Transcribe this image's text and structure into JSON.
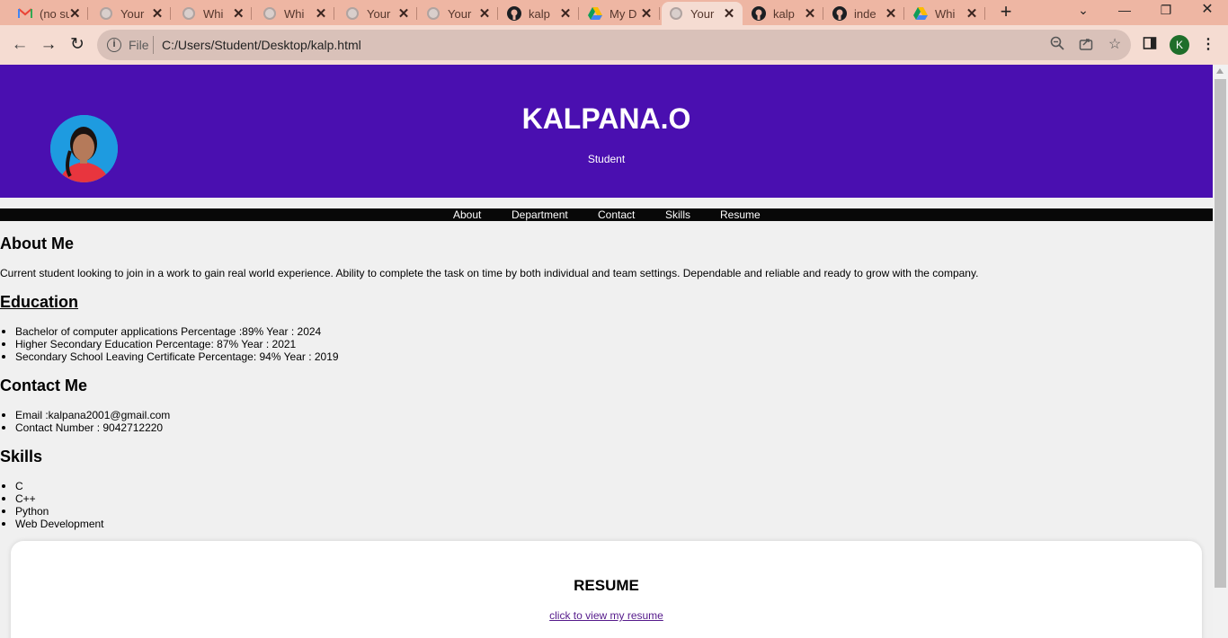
{
  "browser": {
    "tabs": [
      {
        "title": "(no subject)",
        "icon": "gmail-icon"
      },
      {
        "title": "Your",
        "icon": "globe-icon"
      },
      {
        "title": "Whi",
        "icon": "globe-icon"
      },
      {
        "title": "Whi",
        "icon": "globe-icon"
      },
      {
        "title": "Your",
        "icon": "globe-icon"
      },
      {
        "title": "Your",
        "icon": "globe-icon"
      },
      {
        "title": "kalp",
        "icon": "github-icon"
      },
      {
        "title": "My D",
        "icon": "drive-icon"
      },
      {
        "title": "Your",
        "icon": "globe-icon",
        "active": true
      },
      {
        "title": "kalp",
        "icon": "github-icon"
      },
      {
        "title": "inde",
        "icon": "github-icon"
      },
      {
        "title": "Whi",
        "icon": "drive-icon"
      }
    ],
    "address": {
      "scheme_label": "File",
      "url": "C:/Users/Student/Desktop/kalp.html"
    },
    "profile_initial": "K"
  },
  "header": {
    "name": "KALPANA.O",
    "role": "Student",
    "bg_color": "#4a0fb0"
  },
  "nav": {
    "links": [
      "About",
      "Department",
      "Contact",
      "Skills",
      "Resume"
    ]
  },
  "about": {
    "heading": "About Me",
    "text": "Current student looking to join in a work to gain real world experience. Ability to complete the task on time by both individual and team settings. Dependable and reliable and ready to grow with the company."
  },
  "education": {
    "heading": "Education",
    "items": [
      "Bachelor of computer applications Percentage :89% Year : 2024",
      "Higher Secondary Education Percentage: 87% Year : 2021",
      "Secondary School Leaving Certificate Percentage: 94% Year : 2019"
    ]
  },
  "contact": {
    "heading": "Contact Me",
    "items": [
      "Email :kalpana2001@gmail.com",
      "Contact Number : 9042712220"
    ]
  },
  "skills": {
    "heading": "Skills",
    "items": [
      "C",
      "C++",
      "Python",
      "Web Development"
    ]
  },
  "resume": {
    "heading": "RESUME",
    "link_text": "click to view my resume"
  }
}
